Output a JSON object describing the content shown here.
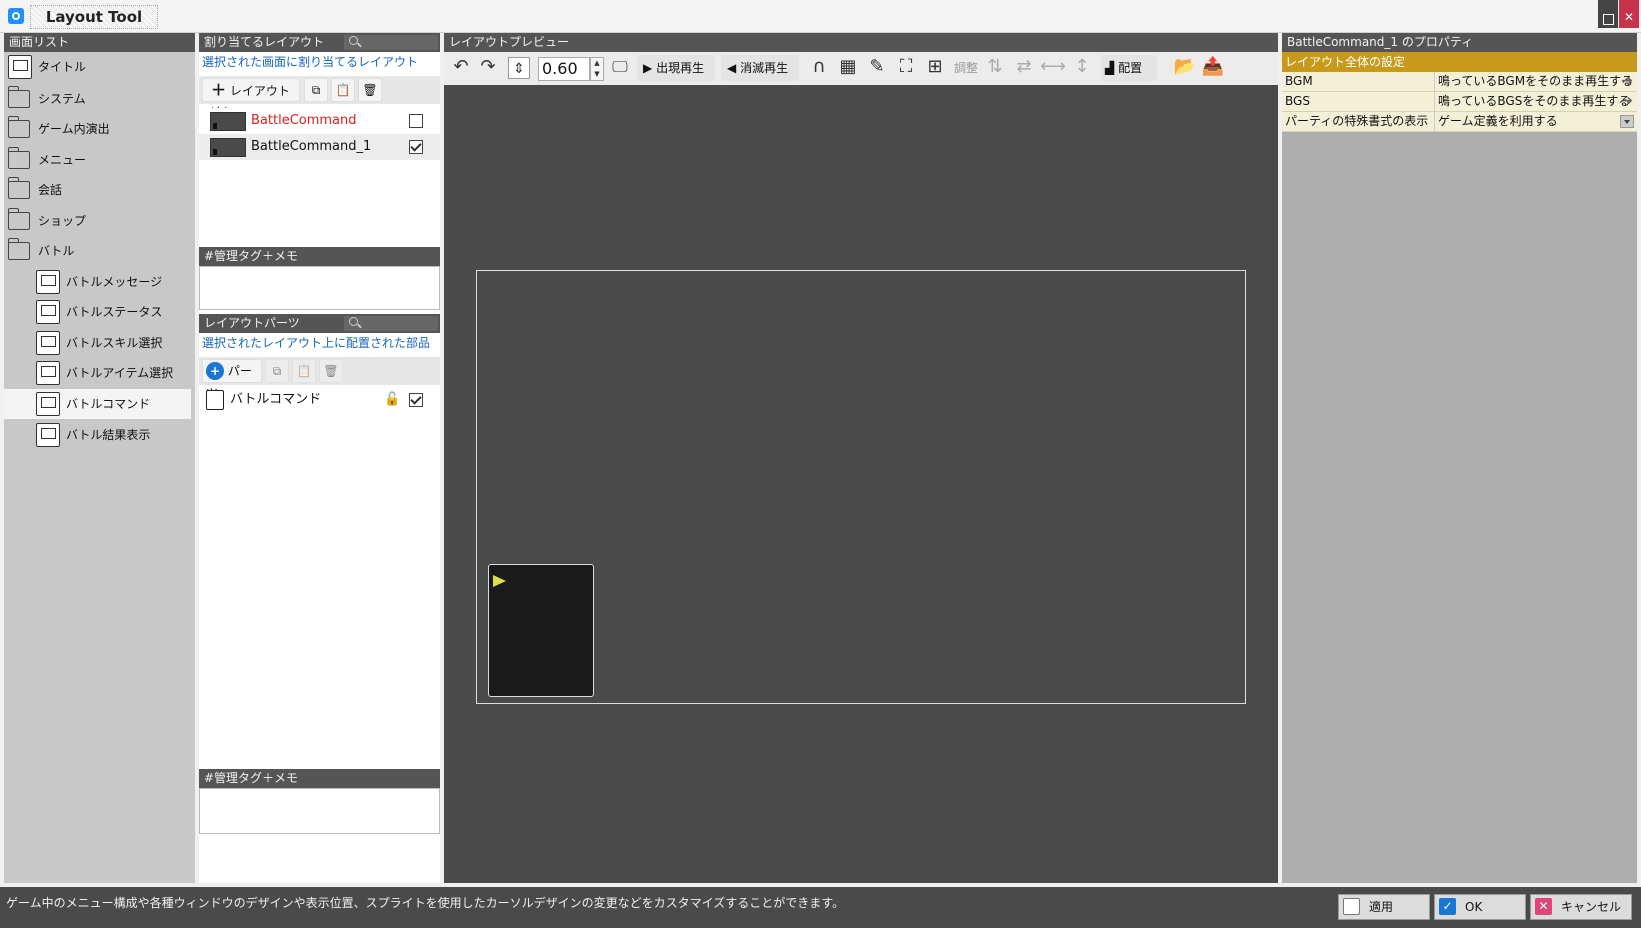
{
  "window": {
    "title": "Layout Tool"
  },
  "screen_list": {
    "header": "画面リスト",
    "items": [
      {
        "label": "タイトル",
        "icon": "monitor-icon",
        "kind": "screen",
        "selected": false
      },
      {
        "label": "システム",
        "icon": "folder-icon",
        "kind": "folder",
        "selected": false
      },
      {
        "label": "ゲーム内演出",
        "icon": "folder-icon",
        "kind": "folder",
        "selected": false
      },
      {
        "label": "メニュー",
        "icon": "folder-icon",
        "kind": "folder",
        "selected": false
      },
      {
        "label": "会話",
        "icon": "folder-icon",
        "kind": "folder",
        "selected": false
      },
      {
        "label": "ショップ",
        "icon": "folder-icon",
        "kind": "folder",
        "selected": false
      },
      {
        "label": "バトル",
        "icon": "folder-icon",
        "kind": "folder",
        "selected": false
      },
      {
        "label": "バトルメッセージ",
        "icon": "battle-message-icon",
        "kind": "screen",
        "selected": false
      },
      {
        "label": "バトルステータス",
        "icon": "battle-status-icon",
        "kind": "screen",
        "selected": false
      },
      {
        "label": "バトルスキル選択",
        "icon": "battle-skill-icon",
        "kind": "screen",
        "selected": false
      },
      {
        "label": "バトルアイテム選択",
        "icon": "battle-item-icon",
        "kind": "screen",
        "selected": false
      },
      {
        "label": "バトルコマンド",
        "icon": "battle-command-icon",
        "kind": "screen",
        "selected": true
      },
      {
        "label": "バトル結果表示",
        "icon": "battle-result-icon",
        "kind": "screen",
        "selected": false
      }
    ]
  },
  "layouts": {
    "header": "割り当てるレイアウト",
    "description": "選択された画面に割り当てるレイアウト",
    "add_label": "レイアウト追加",
    "items": [
      {
        "name": "BattleCommand",
        "checked": false,
        "color": "#e02020"
      },
      {
        "name": "BattleCommand_1",
        "checked": true,
        "color": "#111111"
      }
    ],
    "memo_header": "#管理タグ＋メモ"
  },
  "parts": {
    "header": "レイアウトパーツ",
    "description": "選択されたレイアウト上に配置された部品",
    "add_label": "パーツ",
    "items": [
      {
        "name": "バトルコマンド",
        "checked": true,
        "locked": false
      }
    ],
    "memo_header": "#管理タグ＋メモ"
  },
  "preview": {
    "header": "レイアウトプレビュー",
    "zoom": "0.60",
    "appear_label": "出現再生",
    "vanish_label": "消滅再生",
    "adjust_label": "調整",
    "arrange_label": "配置"
  },
  "properties": {
    "header": "BattleCommand_1 のプロパティ",
    "section": "レイアウト全体の設定",
    "rows": [
      {
        "key": "BGM",
        "value": "鳴っているBGMをそのまま再生する",
        "control": "arrow"
      },
      {
        "key": "BGS",
        "value": "鳴っているBGSをそのまま再生する",
        "control": "arrow"
      },
      {
        "key": "パーティの特殊書式の表示",
        "value": "ゲーム定義を利用する",
        "control": "dropdown"
      }
    ]
  },
  "status": {
    "text": "ゲーム中のメニュー構成や各種ウィンドウのデザインや表示位置、スプライトを使用したカーソルデザインの変更などをカスタマイズすることができます。",
    "apply_label": "適用",
    "ok_label": "OK",
    "cancel_label": "キャンセル"
  },
  "colors": {
    "accent": "#c79a1c",
    "link": "#1565c0",
    "close": "#c8324a"
  }
}
